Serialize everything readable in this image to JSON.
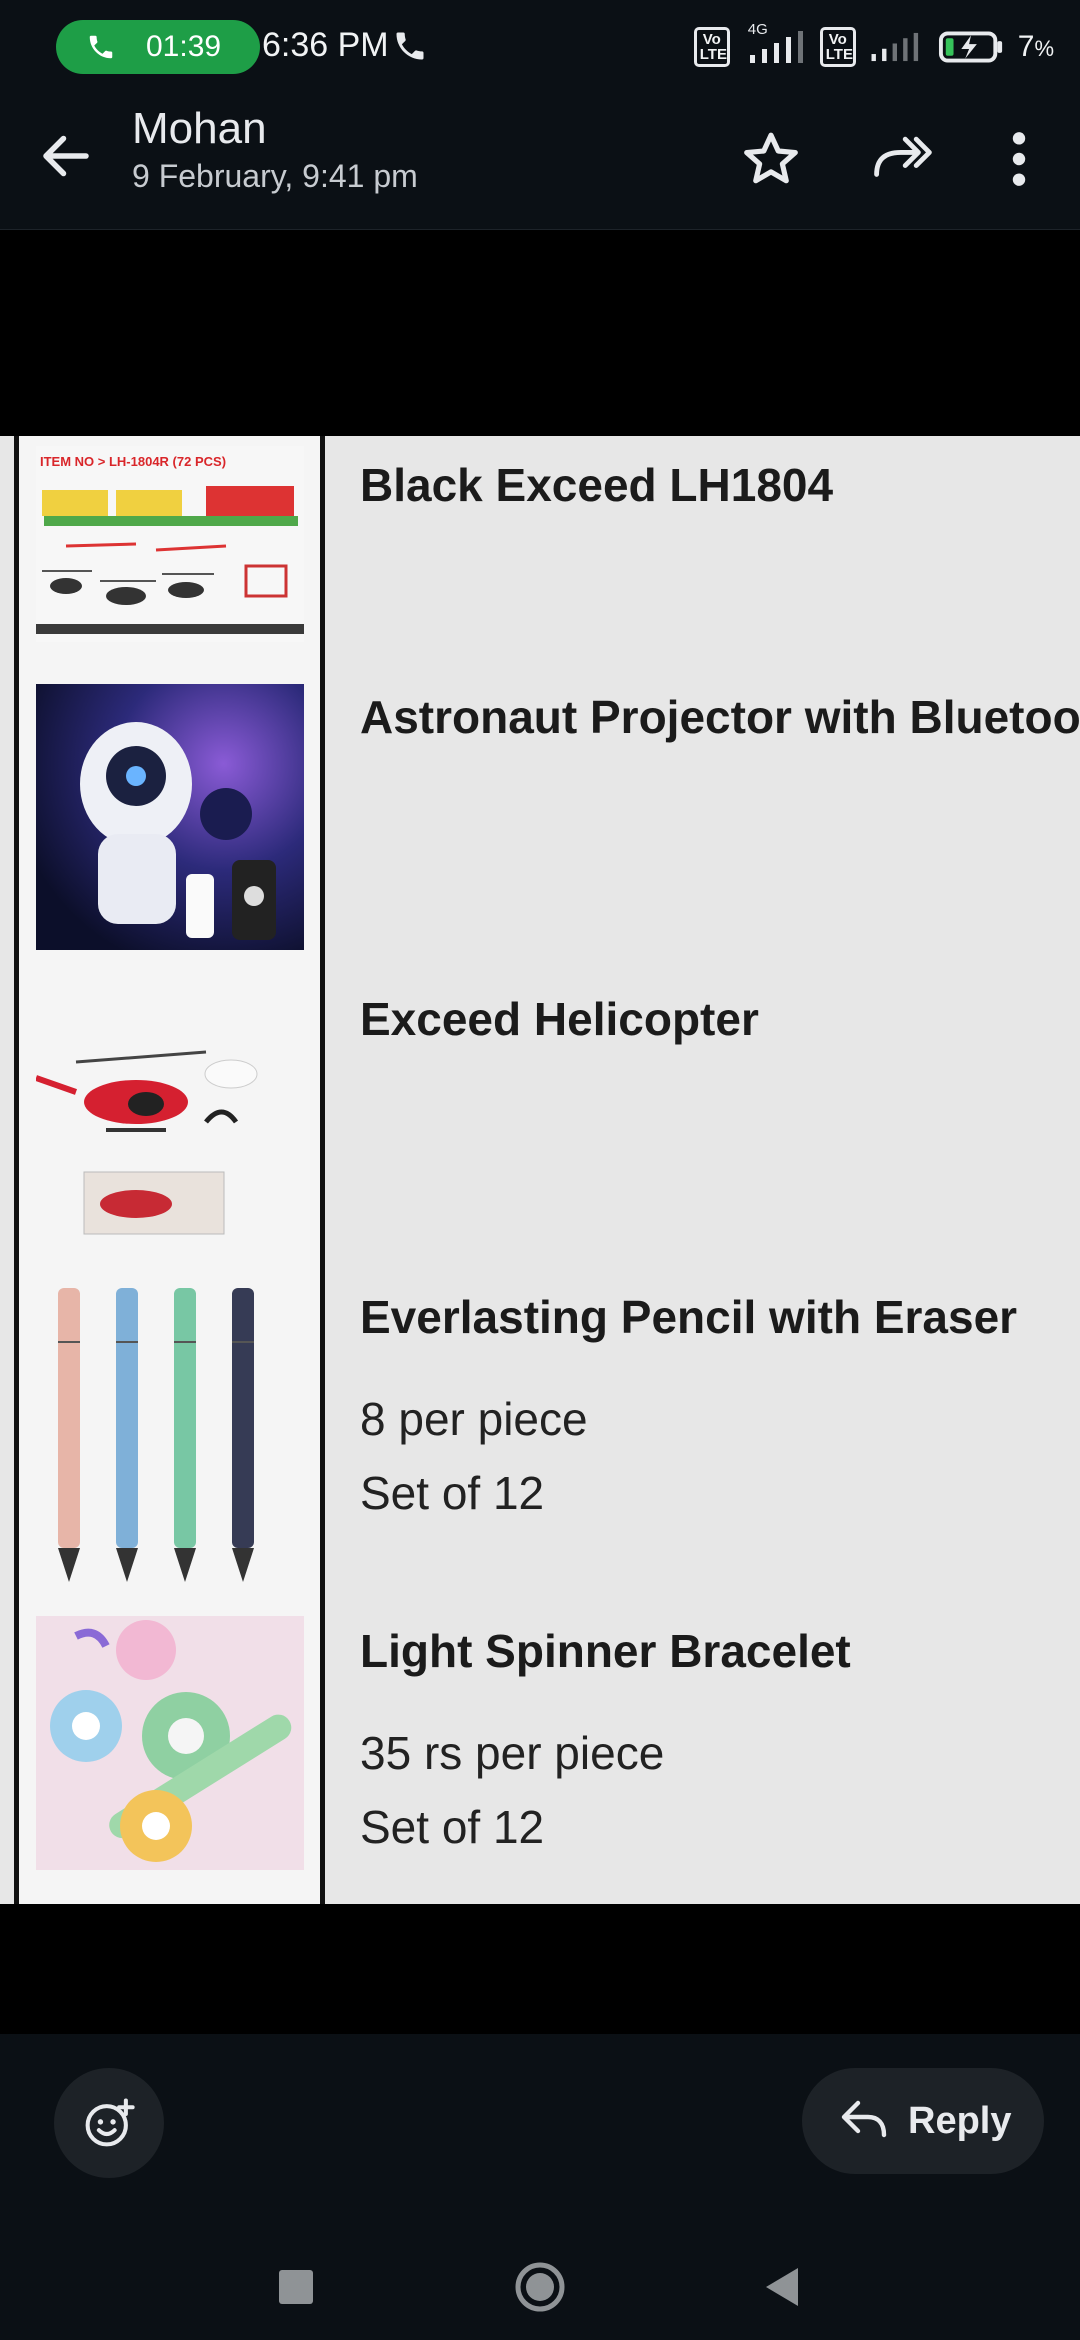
{
  "status_bar": {
    "call_timer": "01:39",
    "time": "6:36 PM",
    "network_label": "4G",
    "volte_label": "Vo\nLTE",
    "battery_percent": "7",
    "battery_unit": "%"
  },
  "header": {
    "contact_name": "Mohan",
    "message_date": "9 February, 9:41 pm"
  },
  "products": [
    {
      "title": "Black Exceed LH1804",
      "lines": [],
      "thumb_caption": "ITEM NO > LH-1804R (72 PCS)"
    },
    {
      "title": "Astronaut Projector with Bluetooth",
      "lines": []
    },
    {
      "title": "Exceed Helicopter",
      "lines": []
    },
    {
      "title": "Everlasting Pencil with Eraser",
      "lines": [
        "8 per piece",
        "Set of 12"
      ]
    },
    {
      "title": "Light Spinner Bracelet",
      "lines": [
        "35 rs per piece",
        "Set of 12"
      ]
    }
  ],
  "bottom_bar": {
    "reply_label": "Reply"
  },
  "colors": {
    "call_pill": "#1e9e47",
    "toolbar_bg": "#0b1015",
    "sheet_bg": "#e7e7e7"
  },
  "icons": [
    "phone-icon",
    "back-arrow-icon",
    "star-icon",
    "forward-icon",
    "more-vert-icon",
    "add-reaction-icon",
    "reply-icon"
  ]
}
